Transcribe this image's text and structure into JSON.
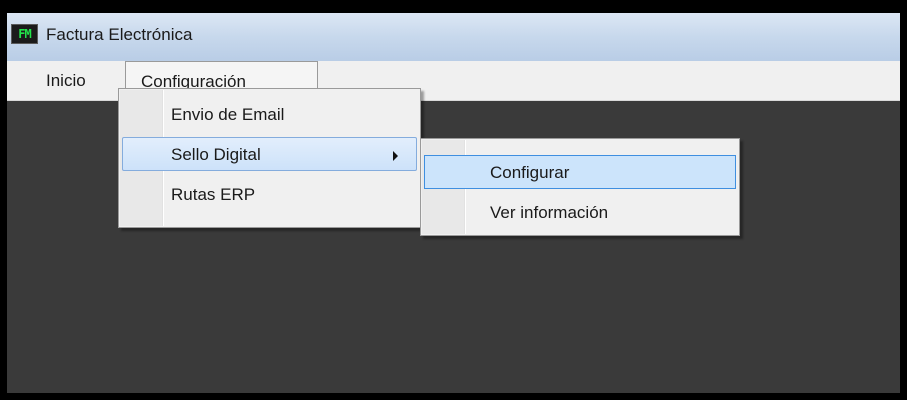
{
  "window": {
    "title": "Factura Electrónica",
    "icon_text": "FM",
    "icon_name": "app-logo-icon"
  },
  "menubar": {
    "items": [
      {
        "label": "Inicio"
      },
      {
        "label": "Configuración",
        "state": "open"
      }
    ]
  },
  "config_menu": {
    "items": [
      {
        "label": "Envio de Email"
      },
      {
        "label": "Sello Digital",
        "state": "highlighted",
        "has_submenu": true
      },
      {
        "label": "Rutas ERP"
      }
    ]
  },
  "sello_submenu": {
    "items": [
      {
        "label": "Configurar",
        "state": "highlighted"
      },
      {
        "label": "Ver información"
      }
    ]
  },
  "colors": {
    "background": "#3a3a3a",
    "menu_highlight": "#cde2fa",
    "menu_highlight_border": "#3f8fe0",
    "icon_text": "#22e34a"
  }
}
